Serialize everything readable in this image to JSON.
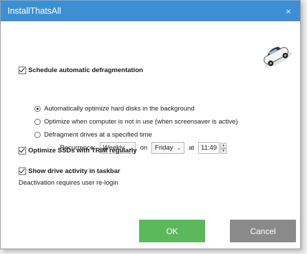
{
  "window": {
    "title": "InstallThatsAll",
    "close_glyph": "×"
  },
  "icons": {
    "car": "car-image",
    "close": "close-icon",
    "spin_up": "spin-up-icon",
    "spin_down": "spin-down-icon"
  },
  "colors": {
    "titlebar": "#3d8fd4",
    "ok": "#5cb85c",
    "cancel": "#8a8a8a"
  },
  "schedule": {
    "label": "Schedule automatic defragmentation",
    "checked": true,
    "options": [
      {
        "label": "Automatically optimize hard disks in the background",
        "selected": true
      },
      {
        "label": "Optimize when computer is not in use (when screensaver is active)",
        "selected": false
      },
      {
        "label": "Defragment drives at a specified time",
        "selected": false
      }
    ],
    "recurrence": {
      "label": "Recurrence:",
      "frequency": "Weekly",
      "on_label": "on",
      "day": "Friday",
      "at_label": "at",
      "time": "11:49"
    }
  },
  "ssd": {
    "label": "Optimize SSDs with TRIM regularly",
    "checked": true
  },
  "taskbar": {
    "label": "Show drive activity in taskbar",
    "checked": true,
    "note": "Deactivation requires user re-login"
  },
  "buttons": {
    "ok": "OK",
    "cancel": "Cancel"
  }
}
